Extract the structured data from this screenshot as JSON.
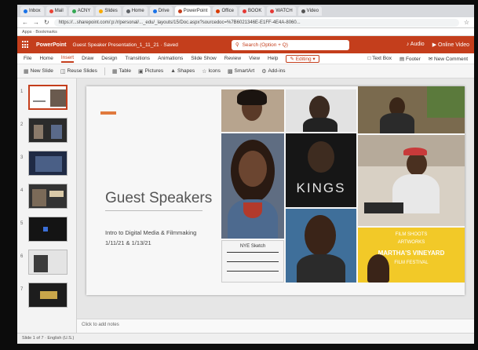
{
  "browser": {
    "tabs": [
      {
        "label": "Inbox",
        "color": "#1a73e8"
      },
      {
        "label": "Mail",
        "color": "#ea4335"
      },
      {
        "label": "ACNY",
        "color": "#34a853"
      },
      {
        "label": "Slides",
        "color": "#f9ab00"
      },
      {
        "label": "Home",
        "color": "#5f6368"
      },
      {
        "label": "Drive",
        "color": "#1a73e8"
      },
      {
        "label": "PowerPoint",
        "color": "#c43e1c",
        "active": true
      },
      {
        "label": "Office",
        "color": "#d83b01"
      },
      {
        "label": "BOOK",
        "color": "#e53935"
      },
      {
        "label": "WATCH",
        "color": "#e53935"
      },
      {
        "label": "Video",
        "color": "#555555"
      }
    ],
    "url": "https://...sharepoint.com/:p:/r/personal/..._edu/_layouts/15/Doc.aspx?sourcedoc=%7B6021346E-E1FF-4E4A-8060...",
    "bookmarks": "Apps  ·  Bookmarks"
  },
  "app": {
    "name": "PowerPoint",
    "document": "Guest Speaker Presentation_1_11_21 · Saved",
    "search_placeholder": "Search (Option + Q)",
    "right_actions": [
      "Audio",
      "Online Video"
    ]
  },
  "ribbon": {
    "tabs": [
      "File",
      "Home",
      "Insert",
      "Draw",
      "Design",
      "Transitions",
      "Animations",
      "Slide Show",
      "Review",
      "View",
      "Help"
    ],
    "active_tab": "Insert",
    "editing_label": "Editing",
    "right_tools": [
      "Text Box",
      "Footer",
      "New Comment"
    ],
    "tools": [
      "New Slide",
      "Reuse Slides",
      "Table",
      "Pictures",
      "Shapes",
      "Icons",
      "SmartArt",
      "Add-ins"
    ]
  },
  "slides": {
    "numbers": [
      "1",
      "2",
      "3",
      "4",
      "5",
      "6",
      "7"
    ]
  },
  "slide": {
    "title": "Guest Speakers",
    "subtitle_line1": "Intro to Digital Media & Filmmaking",
    "subtitle_line2": "1/11/21 & 1/13/21",
    "poster_text": "KINGS",
    "festival_lines": [
      "FILM SHOOTS",
      "ARTWORKS",
      "MARTHA'S VINEYARD",
      "FILM FESTIVAL"
    ],
    "clapper_text": "NYE Sketch"
  },
  "notes_placeholder": "Click to add notes",
  "status": "Slide 1 of 7  ·  English (U.S.)",
  "colors": {
    "accent": "#c43e1c",
    "title_bar_accent": "#e07a3e",
    "festival_yellow": "#f2c928"
  }
}
